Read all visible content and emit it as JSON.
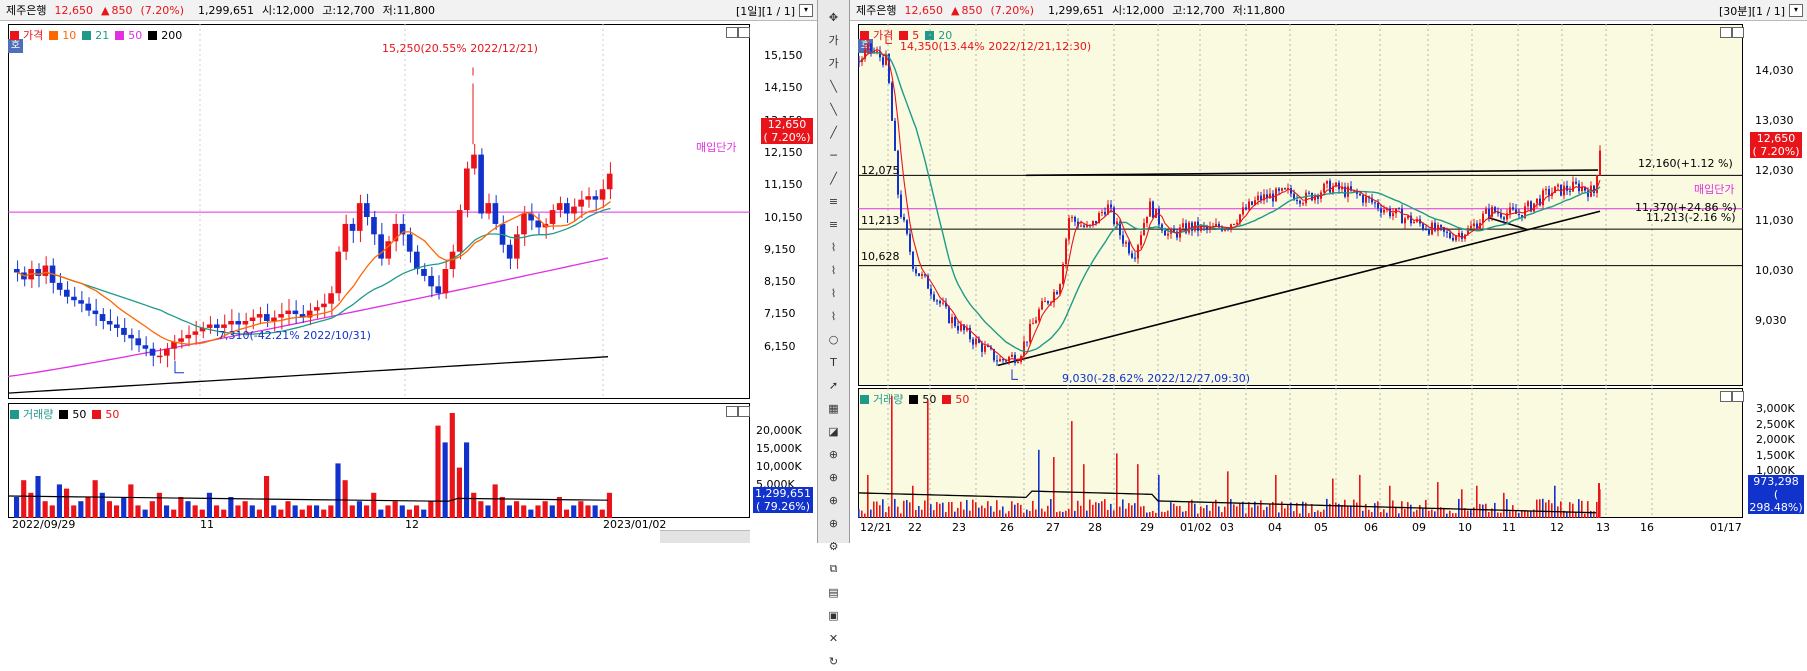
{
  "left": {
    "header": {
      "name": "제주은행",
      "price": "12,650",
      "arrow": "▲",
      "change": "850",
      "pct": "(7.20%)",
      "volume": "1,299,651",
      "open": "시:12,000",
      "high": "고:12,700",
      "low": "저:11,800",
      "page": "[1일][1 / 1]"
    },
    "legend": {
      "label": "가격",
      "ma": [
        "10",
        "21",
        "50",
        "200"
      ]
    },
    "hoga": "호",
    "yaxis": [
      "15,150",
      "14,150",
      "13,150",
      "12,150",
      "11,150",
      "10,150",
      "9,150",
      "8,150",
      "7,150",
      "6,150"
    ],
    "price_box": {
      "value": "12,650",
      "pct": "( 7.20%)"
    },
    "annotations": {
      "high": "15,250(20.55% 2022/12/21)",
      "low": "7,310(-42.21% 2022/10/31)",
      "avg": "매입단가"
    },
    "vol_legend": {
      "label": "거래량",
      "ma": [
        "50",
        "50"
      ]
    },
    "vol_axis": [
      "20,000K",
      "15,000K",
      "10,000K",
      "5,000K"
    ],
    "vol_box": {
      "value": "1,299,651",
      "pct": "( 79.26%)"
    },
    "xaxis": [
      "2022/09/29",
      "11",
      "12",
      "2023/01/02"
    ]
  },
  "right": {
    "header": {
      "name": "제주은행",
      "price": "12,650",
      "arrow": "▲",
      "change": "850",
      "pct": "(7.20%)",
      "volume": "1,299,651",
      "open": "시:12,000",
      "high": "고:12,700",
      "low": "저:11,800",
      "page": "[30분][1 / 1]"
    },
    "legend": {
      "label": "가격",
      "ma": [
        "5",
        "20"
      ]
    },
    "hoga": "호",
    "yaxis": [
      "14,030",
      "13,030",
      "12,030",
      "11,030",
      "10,030",
      "9,030"
    ],
    "price_box": {
      "value": "12,650",
      "pct": "( 7.20%)"
    },
    "annotations": {
      "high": "14,350(13.44% 2022/12/21,12:30)",
      "low": "9,030(-28.62% 2022/12/27,09:30)",
      "line1": "12,160(+1.12 %)",
      "line2": "11,370(+24.86 %)",
      "line3": "11,213(-2.16 %)",
      "avg": "매입단가"
    },
    "hlines": [
      "12,075",
      "11,213",
      "10,628"
    ],
    "vol_legend": {
      "label": "거래량",
      "ma": [
        "50",
        "50"
      ]
    },
    "vol_axis": [
      "3,000K",
      "2,500K",
      "2,000K",
      "1,500K",
      "1,000K",
      "500K",
      "0K"
    ],
    "vol_box": {
      "value": "973,298",
      "pct": "( 298.48%)"
    },
    "xaxis": [
      "12/21",
      "22",
      "23",
      "26",
      "27",
      "28",
      "29",
      "01/02",
      "03",
      "04",
      "05",
      "06",
      "09",
      "10",
      "11",
      "12",
      "13",
      "16",
      "01/17"
    ]
  },
  "toolbar": {
    "icons": [
      "crosshair-icon",
      "price-icon",
      "price-icon",
      "line-tool-icon",
      "line-tool-icon",
      "line-tool-icon",
      "line-tool-icon",
      "line-tool-icon",
      "fibo-icon",
      "fibo-icon",
      "channel-icon",
      "channel-icon",
      "channel-icon",
      "channel-icon",
      "cycle-icon",
      "text-icon",
      "arrow-icon",
      "grid-icon",
      "indicator-icon",
      "zoom-icon",
      "zoom-icon",
      "zoom-icon",
      "zoom-icon",
      "settings-icon",
      "copy-icon",
      "print-icon",
      "save-icon",
      "delete-icon",
      "refresh-icon"
    ]
  },
  "colors": {
    "up": "#e8141a",
    "down": "#1133cc",
    "ma10": "#ff6600",
    "ma21": "#1f9a8a",
    "ma50": "#e030e0",
    "ma200": "#000000",
    "bg_right": "#fafae0"
  }
}
